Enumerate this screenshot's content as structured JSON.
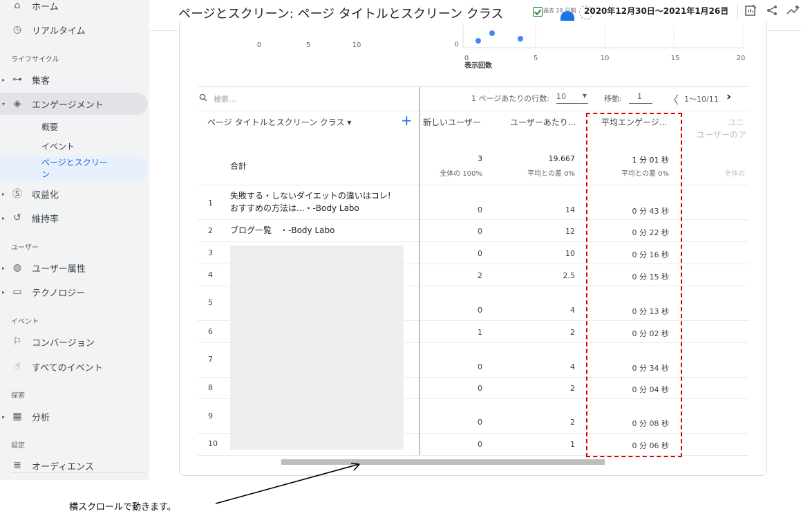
{
  "sidebar": {
    "home": "ホーム",
    "realtime": "リアルタイム",
    "section_lifecycle": "ライフサイクル",
    "acquisition": "集客",
    "engagement": "エンゲージメント",
    "overview": "概要",
    "events": "イベント",
    "pages_screens": "ページとスクリー ン",
    "monetization": "収益化",
    "retention": "維持率",
    "section_user": "ユーザー",
    "user_attributes": "ユーザー属性",
    "technology": "テクノロジー",
    "section_event": "イベント",
    "conversions": "コンバージョン",
    "all_events": "すべてのイベント",
    "section_explore": "探索",
    "analysis": "分析",
    "section_settings": "設定",
    "audiences": "オーディエンス"
  },
  "header": {
    "title": "ページとスクリーン: ページ タイトルとスクリーン クラス",
    "period": "過去 28 日間",
    "date_range": "2020年12月30日～2021年1月26日"
  },
  "chart": {
    "left_ticks": [
      "0",
      "5",
      "10"
    ],
    "right_ticks": [
      "0",
      "5",
      "10",
      "15",
      "20"
    ],
    "right_y_tick": "0",
    "x_label": "表示回数",
    "point_color": "#4285f4"
  },
  "table": {
    "search_placeholder": "検索...",
    "rows_per_page_label": "1 ページあたりの行数:",
    "rows_per_page": "10",
    "goto_label": "移動:",
    "goto_value": "1",
    "page_range": "1〜10/11",
    "dimension_header": "ページ タイトルとスクリーン クラス ▾",
    "col_new_users": "新しいユーザー",
    "col_per_user": "ユーザーあたり...",
    "col_avg_engagement": "平均エンゲージ...",
    "col_unique_top": "ユニ",
    "col_unique_bottom": "ユーザーのア",
    "total_label": "合計",
    "total_new_users": "3",
    "total_new_users_sub": "全体の 100%",
    "total_per_user": "19.667",
    "total_per_user_sub": "平均との差 0%",
    "total_avg": "1 分 01 秒",
    "total_avg_sub": "平均との差 0%",
    "total_extra_sub": "全体の",
    "rows": [
      {
        "num": "1",
        "title1": "失敗する・しないダイエットの違いはコレ!",
        "title2": "おすすめの方法は...・-Body Labo",
        "new_users": "0",
        "per_user": "14",
        "avg": "0 分 43 秒"
      },
      {
        "num": "2",
        "title1": "ブログ一覧　・-Body Labo",
        "title2": "",
        "new_users": "0",
        "per_user": "12",
        "avg": "0 分 22 秒"
      },
      {
        "num": "3",
        "title1": "",
        "title2": "",
        "new_users": "0",
        "per_user": "10",
        "avg": "0 分 16 秒"
      },
      {
        "num": "4",
        "title1": "",
        "title2": "",
        "new_users": "2",
        "per_user": "2.5",
        "avg": "0 分 15 秒"
      },
      {
        "num": "5",
        "title1": "",
        "title2": "",
        "new_users": "0",
        "per_user": "4",
        "avg": "0 分 13 秒"
      },
      {
        "num": "6",
        "title1": "",
        "title2": "",
        "new_users": "1",
        "per_user": "2",
        "avg": "0 分 02 秒"
      },
      {
        "num": "7",
        "title1": "",
        "title2": "",
        "new_users": "0",
        "per_user": "4",
        "avg": "0 分 34 秒"
      },
      {
        "num": "8",
        "title1": "",
        "title2": "",
        "new_users": "0",
        "per_user": "2",
        "avg": "0 分 04 秒"
      },
      {
        "num": "9",
        "title1": "",
        "title2": "",
        "new_users": "0",
        "per_user": "2",
        "avg": "0 分 08 秒"
      },
      {
        "num": "10",
        "title1": "",
        "title2": "",
        "new_users": "0",
        "per_user": "1",
        "avg": "0 分 06 秒"
      }
    ]
  },
  "annotation": {
    "text": "横スクロールで動きます。",
    "highlight_color": "#d50000"
  }
}
